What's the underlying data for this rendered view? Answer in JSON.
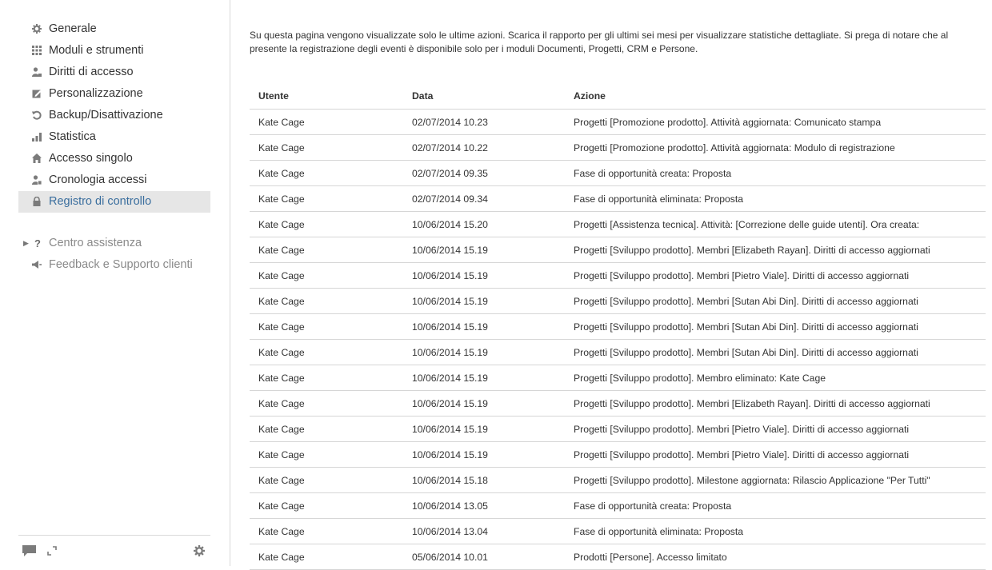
{
  "sidebar": {
    "items": [
      {
        "label": "Generale",
        "icon": "gear-icon"
      },
      {
        "label": "Moduli e strumenti",
        "icon": "grid-icon"
      },
      {
        "label": "Diritti di accesso",
        "icon": "user-key-icon"
      },
      {
        "label": "Personalizzazione",
        "icon": "edit-icon"
      },
      {
        "label": "Backup/Disattivazione",
        "icon": "restore-icon"
      },
      {
        "label": "Statistica",
        "icon": "bar-chart-icon"
      },
      {
        "label": "Accesso singolo",
        "icon": "home-icon"
      },
      {
        "label": "Cronologia accessi",
        "icon": "user-history-icon"
      },
      {
        "label": "Registro di controllo",
        "icon": "lock-icon",
        "active": true
      }
    ],
    "help": [
      {
        "label": "Centro assistenza",
        "icon": "question-icon"
      },
      {
        "label": "Feedback e Supporto clienti",
        "icon": "megaphone-icon"
      }
    ],
    "footer_icons": [
      "chat-icon",
      "expand-icon",
      "settings-gear-icon"
    ]
  },
  "main": {
    "intro": "Su questa pagina vengono visualizzate solo le ultime azioni. Scarica il rapporto per gli ultimi sei mesi per visualizzare statistiche dettagliate. Si prega di notare che al presente la registrazione degli eventi è disponibile solo per i moduli Documenti, Progetti, CRM e Persone.",
    "table": {
      "headers": [
        "Utente",
        "Data",
        "Azione"
      ],
      "rows": [
        [
          "Kate Cage",
          "02/07/2014 10.23",
          "Progetti [Promozione prodotto]. Attività aggiornata: Comunicato stampa"
        ],
        [
          "Kate Cage",
          "02/07/2014 10.22",
          "Progetti [Promozione prodotto]. Attività aggiornata: Modulo di registrazione"
        ],
        [
          "Kate Cage",
          "02/07/2014 09.35",
          "Fase di opportunità creata: Proposta"
        ],
        [
          "Kate Cage",
          "02/07/2014 09.34",
          "Fase di opportunità eliminata: Proposta"
        ],
        [
          "Kate Cage",
          "10/06/2014 15.20",
          "Progetti [Assistenza tecnica]. Attività: [Correzione delle guide utenti]. Ora creata:"
        ],
        [
          "Kate Cage",
          "10/06/2014 15.19",
          "Progetti [Sviluppo prodotto]. Membri [Elizabeth Rayan]. Diritti di accesso aggiornati"
        ],
        [
          "Kate Cage",
          "10/06/2014 15.19",
          "Progetti [Sviluppo prodotto]. Membri [Pietro Viale]. Diritti di accesso aggiornati"
        ],
        [
          "Kate Cage",
          "10/06/2014 15.19",
          "Progetti [Sviluppo prodotto]. Membri [Sutan Abi Din]. Diritti di accesso aggiornati"
        ],
        [
          "Kate Cage",
          "10/06/2014 15.19",
          "Progetti [Sviluppo prodotto]. Membri [Sutan Abi Din]. Diritti di accesso aggiornati"
        ],
        [
          "Kate Cage",
          "10/06/2014 15.19",
          "Progetti [Sviluppo prodotto]. Membri [Sutan Abi Din]. Diritti di accesso aggiornati"
        ],
        [
          "Kate Cage",
          "10/06/2014 15.19",
          "Progetti [Sviluppo prodotto]. Membro eliminato: Kate Cage"
        ],
        [
          "Kate Cage",
          "10/06/2014 15.19",
          "Progetti [Sviluppo prodotto]. Membri [Elizabeth Rayan]. Diritti di accesso aggiornati"
        ],
        [
          "Kate Cage",
          "10/06/2014 15.19",
          "Progetti [Sviluppo prodotto]. Membri [Pietro Viale]. Diritti di accesso aggiornati"
        ],
        [
          "Kate Cage",
          "10/06/2014 15.19",
          "Progetti [Sviluppo prodotto]. Membri [Pietro Viale]. Diritti di accesso aggiornati"
        ],
        [
          "Kate Cage",
          "10/06/2014 15.18",
          "Progetti [Sviluppo prodotto]. Milestone aggiornata: Rilascio Applicazione \"Per Tutti\""
        ],
        [
          "Kate Cage",
          "10/06/2014 13.05",
          "Fase di opportunità creata: Proposta"
        ],
        [
          "Kate Cage",
          "10/06/2014 13.04",
          "Fase di opportunità eliminata: Proposta"
        ],
        [
          "Kate Cage",
          "05/06/2014 10.01",
          "Prodotti [Persone]. Accesso limitato"
        ]
      ]
    }
  },
  "colors": {
    "active_bg": "#e6e6e6",
    "active_text": "#3a6e9e",
    "border": "#d6d6d6"
  }
}
